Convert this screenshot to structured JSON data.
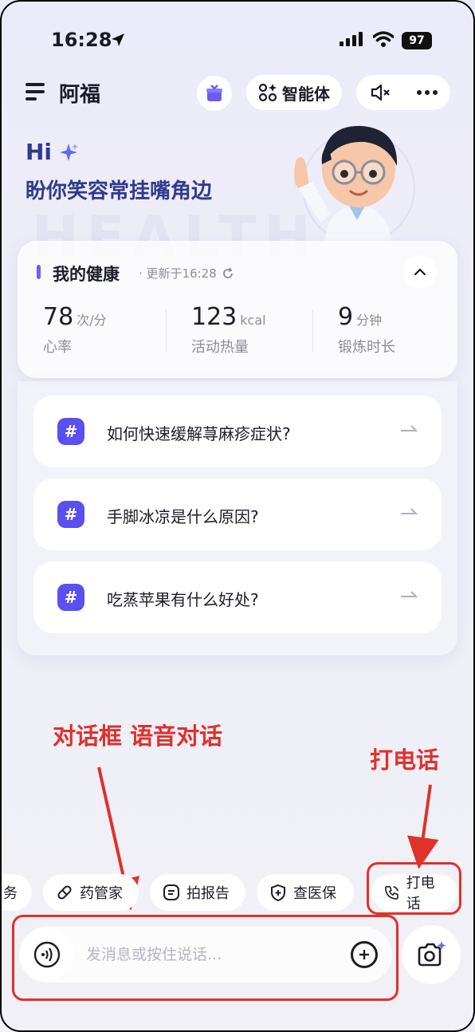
{
  "status_bar": {
    "time": "16:28",
    "battery": "97"
  },
  "header": {
    "title": "阿福",
    "agent_label": "智能体"
  },
  "greeting": {
    "hi": "Hi",
    "slogan": "盼你笑容常挂嘴角边"
  },
  "health": {
    "title": "我的健康",
    "updated": "· 更新于16:28",
    "stats": [
      {
        "value": "78",
        "unit": "次/分",
        "label": "心率"
      },
      {
        "value": "123",
        "unit": "kcal",
        "label": "活动热量"
      },
      {
        "value": "9",
        "unit": "分钟",
        "label": "锻炼时长"
      }
    ]
  },
  "questions": [
    {
      "icon": "#",
      "text": "如何快速缓解荨麻疹症状?"
    },
    {
      "icon": "#",
      "text": "手脚冰凉是什么原因?"
    },
    {
      "icon": "#",
      "text": "吃蒸苹果有什么好处?"
    }
  ],
  "annotations": {
    "dialog": "对话框 语音对话",
    "call": "打电话"
  },
  "quick_actions": [
    {
      "label": "务",
      "icon": ""
    },
    {
      "label": "药管家",
      "icon": "pill-icon"
    },
    {
      "label": "拍报告",
      "icon": "report-icon"
    },
    {
      "label": "查医保",
      "icon": "insurance-icon"
    },
    {
      "label": "打电话",
      "icon": "phone-icon"
    }
  ],
  "input": {
    "placeholder": "发消息或按住说话..."
  },
  "colors": {
    "accent": "#5a4ff0",
    "annotation": "#e0312b",
    "heading": "#2f3a8f"
  }
}
